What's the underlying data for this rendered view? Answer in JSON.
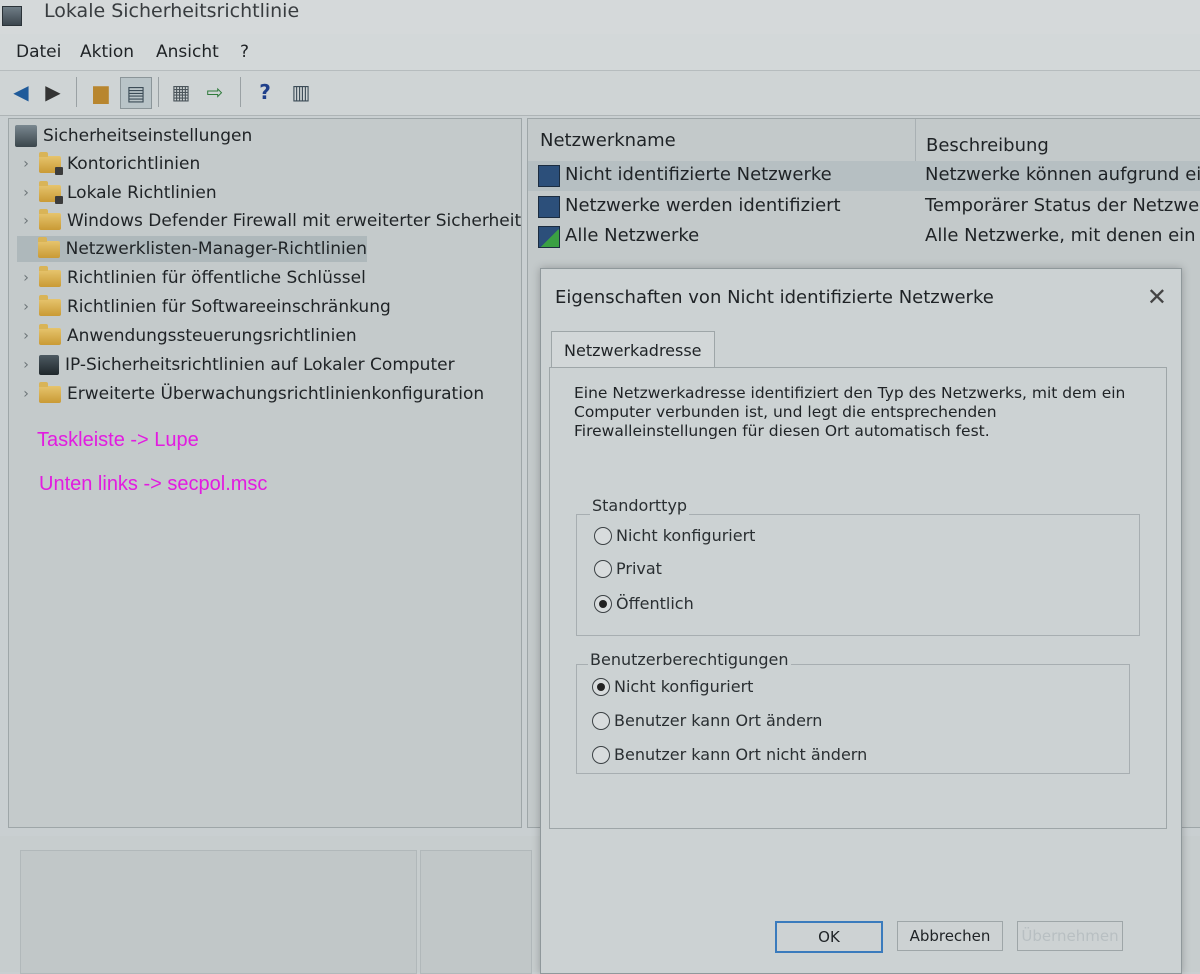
{
  "window": {
    "title": "Lokale Sicherheitsrichtlinie"
  },
  "menu": [
    "Datei",
    "Aktion",
    "Ansicht",
    "?"
  ],
  "toolbar": {
    "icons": [
      "back-arrow-icon",
      "forward-arrow-icon",
      "up-folder-icon",
      "show-hide-tree-icon",
      "properties-icon",
      "export-list-icon",
      "help-icon",
      "console-view-icon"
    ]
  },
  "tree": {
    "root": "Sicherheitseinstellungen",
    "items": [
      "Kontorichtlinien",
      "Lokale Richtlinien",
      "Windows Defender Firewall mit erweiterter Sicherheit",
      "Netzwerklisten-Manager-Richtlinien",
      "Richtlinien für öffentliche Schlüssel",
      "Richtlinien für Softwareeinschränkung",
      "Anwendungssteuerungsrichtlinien",
      "IP-Sicherheitsrichtlinien auf Lokaler Computer",
      "Erweiterte Überwachungsrichtlinienkonfiguration"
    ],
    "selected": "Netzwerklisten-Manager-Richtlinien"
  },
  "annotations": [
    "Taskleiste -> Lupe",
    "Unten links -> secpol.msc"
  ],
  "list": {
    "columns": [
      "Netzwerkname",
      "Beschreibung"
    ],
    "rows": [
      {
        "name": "Nicht identifizierte Netzwerke",
        "desc": "Netzwerke können aufgrund eine"
      },
      {
        "name": "Netzwerke werden identifiziert",
        "desc": "Temporärer Status der Netzwerke"
      },
      {
        "name": "Alle Netzwerke",
        "desc": "Alle Netzwerke, mit denen ein Be"
      }
    ]
  },
  "dialog": {
    "title": "Eigenschaften von Nicht identifizierte Netzwerke",
    "close": "✕",
    "tab": "Netzwerkadresse",
    "intro": "Eine Netzwerkadresse identifiziert den Typ des Netzwerks, mit dem ein Computer verbunden ist, und legt die entsprechenden Firewalleinstellungen für diesen Ort automatisch fest.",
    "location_group": {
      "title": "Standorttyp",
      "options": [
        "Nicht konfiguriert",
        "Privat",
        "Öffentlich"
      ],
      "selected_index": 2
    },
    "permission_group": {
      "title": "Benutzerberechtigungen",
      "options": [
        "Nicht konfiguriert",
        "Benutzer kann Ort ändern",
        "Benutzer kann Ort nicht ändern"
      ],
      "selected_index": 0
    },
    "buttons": {
      "ok": "OK",
      "cancel": "Abbrechen",
      "apply": "Übernehmen"
    }
  }
}
